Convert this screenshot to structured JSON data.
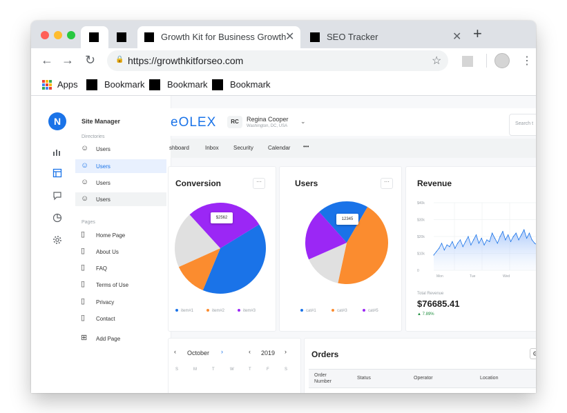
{
  "browser": {
    "tabs": [
      {
        "title": ""
      },
      {
        "title": ""
      },
      {
        "title": "Growth Kit for Business Growth",
        "active": true
      },
      {
        "title": "SEO Tracker"
      }
    ],
    "url": "https://growthkitforseo.com",
    "bookmarks": {
      "apps_label": "Apps",
      "items": [
        "Bookmark",
        "Bookmark",
        "Bookmark"
      ]
    }
  },
  "rail": {
    "logo_letter": "N",
    "icons": [
      "bar-chart-icon",
      "layout-icon",
      "chat-icon",
      "pie-chart-icon",
      "settings-icon"
    ]
  },
  "site_manager": {
    "title": "Site Manager",
    "directories_label": "Directories",
    "directories": [
      {
        "label": "Users",
        "state": ""
      },
      {
        "label": "Users",
        "state": "selected"
      },
      {
        "label": "Users",
        "state": ""
      },
      {
        "label": "Users",
        "state": "hover"
      }
    ],
    "pages_label": "Pages",
    "pages": [
      "Home Page",
      "About Us",
      "FAQ",
      "Terms of Use",
      "Privacy",
      "Contact"
    ],
    "add_page": "Add Page"
  },
  "header": {
    "brand": "eOLEX",
    "user_initials": "RC",
    "user_name": "Regina Cooper",
    "user_location": "Washington, DC, USA",
    "search_placeholder": "Search t"
  },
  "nav": [
    "shboard",
    "Inbox",
    "Security",
    "Calendar",
    "•••"
  ],
  "colors": {
    "blue": "#1a73e8",
    "orange": "#fb8c2f",
    "purple": "#9b27f5",
    "gray": "#e0e0e0"
  },
  "conversion": {
    "title": "Conversion",
    "tooltip": "$2562",
    "legend": [
      "item#1",
      "item#2",
      "item#3"
    ]
  },
  "users": {
    "title": "Users",
    "tooltip": "12345",
    "legend": [
      "cat#1",
      "cat#3",
      "cat#5"
    ]
  },
  "revenue": {
    "title": "Revenue",
    "total_label": "Total Revenue",
    "total": "$76685.41",
    "change": "▲ 7.89%"
  },
  "calendar": {
    "month": "October",
    "year": "2019",
    "days": [
      "S",
      "M",
      "T",
      "W",
      "T",
      "F",
      "S"
    ]
  },
  "orders": {
    "title": "Orders",
    "columns": [
      "Order Number",
      "Status",
      "Operator",
      "Location"
    ]
  },
  "chart_data": [
    {
      "type": "pie",
      "title": "Conversion",
      "categories": [
        "item#1",
        "item#2",
        "item#3"
      ],
      "values": [
        40,
        12,
        28
      ],
      "extra_gray_segment": 20
    },
    {
      "type": "pie",
      "title": "Users",
      "categories": [
        "cat#1",
        "cat#3",
        "cat#5"
      ],
      "values": [
        20,
        45,
        20
      ],
      "extra_gray_segment": 15
    },
    {
      "type": "area",
      "title": "Revenue",
      "categories": [
        "Mon",
        "Tue",
        "Wed",
        "T"
      ],
      "yticks": [
        "$40k",
        "$30k",
        "$20k",
        "$10k",
        "0"
      ],
      "ylim": [
        0,
        40000
      ],
      "grid": true,
      "values": [
        9000,
        11000,
        13000,
        16000,
        12000,
        15000,
        14000,
        17000,
        13000,
        16000,
        18000,
        14000,
        17000,
        20000,
        15000,
        18000,
        21000,
        16000,
        19000,
        15000,
        18000,
        17000,
        22000,
        19000,
        16000,
        20000,
        23000,
        18000,
        21000,
        17000,
        20000,
        22000,
        18000,
        21000,
        24000,
        19000,
        22000,
        18000,
        16000,
        15000
      ]
    }
  ]
}
